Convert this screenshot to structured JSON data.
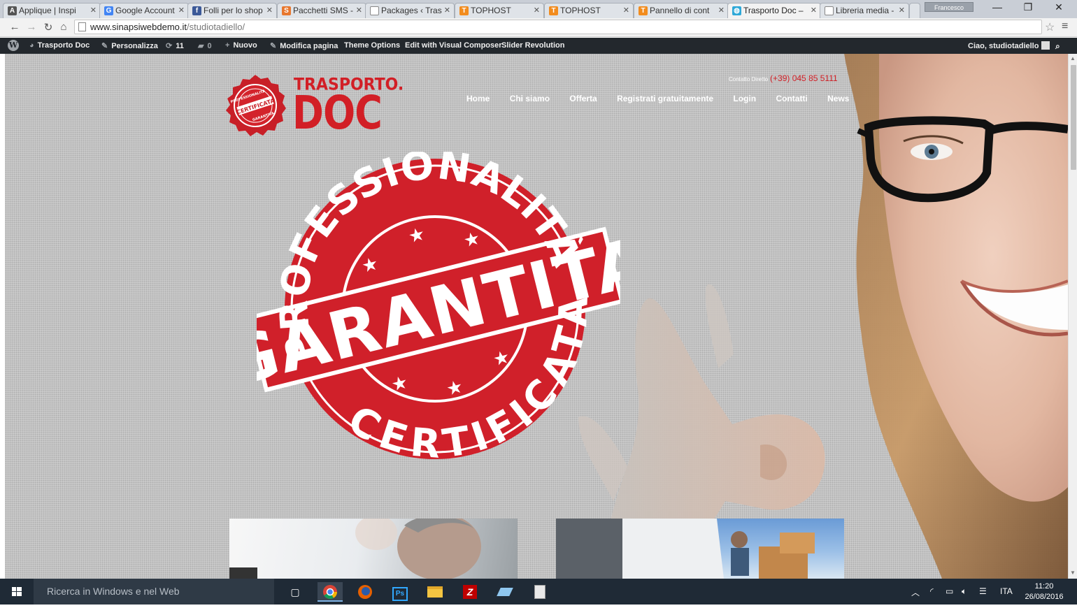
{
  "browser": {
    "tabs": [
      {
        "title": "Applique | Inspi",
        "favicon": "A",
        "favicon_color": "#555555"
      },
      {
        "title": "Google Account",
        "favicon": "G",
        "favicon_color": "#4285f4"
      },
      {
        "title": "Folli per lo shop",
        "favicon": "f",
        "favicon_color": "#3b5998"
      },
      {
        "title": "Pacchetti SMS -",
        "favicon": "S",
        "favicon_color": "#e8772e"
      },
      {
        "title": "Packages ‹ Tras",
        "favicon": "",
        "favicon_color": "#ffffff"
      },
      {
        "title": "TOPHOST",
        "favicon": "T",
        "favicon_color": "#f28c1e"
      },
      {
        "title": "TOPHOST",
        "favicon": "T",
        "favicon_color": "#f28c1e"
      },
      {
        "title": "Pannello di cont",
        "favicon": "T",
        "favicon_color": "#f28c1e"
      },
      {
        "title": "Trasporto Doc –",
        "favicon": "◍",
        "favicon_color": "#2ea8d8"
      },
      {
        "title": "Libreria media -",
        "favicon": "",
        "favicon_color": "#ffffff"
      }
    ],
    "profile_name": "Francesco",
    "url_domain": "www.sinapsiwebdemo.it",
    "url_path": "/studiotadiello/"
  },
  "wp_admin_bar": {
    "site_name": "Trasporto Doc",
    "customize": "Personalizza",
    "updates_count": "11",
    "comments_count": "0",
    "new_label": "Nuovo",
    "edit_page": "Modifica pagina",
    "theme_options": "Theme Options",
    "visual_composer": "Edit with Visual Composer",
    "slider_revolution": "Slider Revolution",
    "greeting": "Ciao, studiotadiello"
  },
  "site": {
    "logo_top": "TRASPORTO.",
    "logo_main": "DOC",
    "logo_seal_text": [
      "PROFESSIONALITÀ",
      "CERTIFICATA",
      "GARANTITA"
    ],
    "contact_label": "Contatto Diretto",
    "contact_phone": "(+39) 045 85 5111",
    "nav": [
      "Home",
      "Chi siamo",
      "Offerta",
      "Registrati gratuitamente",
      "Login",
      "Contatti",
      "News"
    ],
    "stamp": {
      "top_arc": "PROFESSIONALITÀ",
      "center": "GARANTITA",
      "bottom_arc": "CERTIFICATA",
      "color": "#d0202a"
    }
  },
  "taskbar": {
    "search_placeholder": "Ricerca in Windows e nel Web",
    "apps": [
      "task-view-icon",
      "chrome-icon",
      "firefox-icon",
      "photoshop-icon",
      "file-explorer-icon",
      "filezilla-icon",
      "notepad-icon",
      "installer-icon"
    ],
    "language": "ITA",
    "time": "11:20",
    "date": "26/08/2016"
  }
}
